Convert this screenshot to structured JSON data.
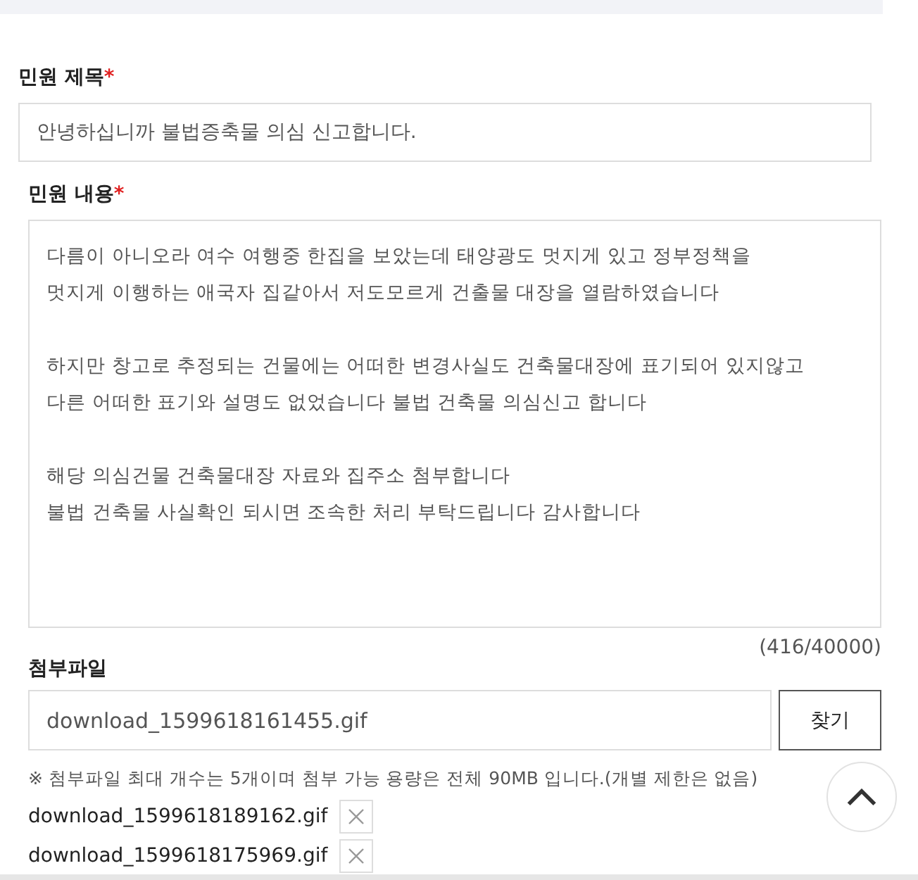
{
  "title_field": {
    "label": "민원 제목",
    "required_mark": "*",
    "value": "안녕하십니까 불법증축물 의심 신고합니다."
  },
  "content_field": {
    "label": "민원 내용",
    "required_mark": "*",
    "paragraphs": [
      {
        "lines": [
          "다름이 아니오라 여수 여행중 한집을 보았는데 태양광도 멋지게 있고 정부정책을",
          "멋지게 이행하는 애국자 집같아서 저도모르게 건출물 대장을 열람하였습니다"
        ]
      },
      {
        "lines": [
          "하지만 창고로 추정되는 건물에는 어떠한 변경사실도 건축물대장에 표기되어 있지않고",
          "다른 어떠한 표기와 설명도 없었습니다 불법 건축물 의심신고 합니다"
        ]
      },
      {
        "lines": [
          "해당 의심건물 건축물대장 자료와 집주소 첨부합니다",
          "불법 건축물 사실확인 되시면 조속한 처리 부탁드립니다 감사합니다"
        ]
      }
    ],
    "counter": "(416/40000)"
  },
  "attachment": {
    "label": "첨부파일",
    "value": "download_1599618161455.gif",
    "button": "찾기",
    "note": "※ 첨부파일 최대 개수는 5개이며 첨부 가능 용량은 전체 90MB 입니다.(개별 제한은 없음)",
    "files": [
      {
        "name": "download_1599618189162.gif"
      },
      {
        "name": "download_1599618175969.gif"
      }
    ]
  }
}
